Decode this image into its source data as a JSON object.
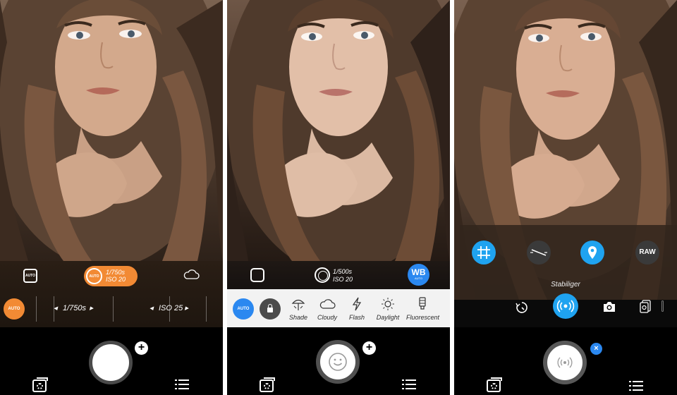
{
  "panel1": {
    "mode_icon_label": "AUTO",
    "exposure_pill": {
      "ring_label": "AUTO",
      "shutter": "1/750s",
      "iso": "ISO 20"
    },
    "auto_button": "AUTO",
    "shutter_dial": "1/750s",
    "iso_dial": "ISO 25",
    "icons": {
      "mode": "auto-mode-icon",
      "weather": "cloud-icon",
      "gallery": "gallery-icon",
      "menu": "list-icon",
      "add": "plus-icon"
    },
    "accent_color": "#f28a34"
  },
  "panel2": {
    "exposure": {
      "shutter": "1/500s",
      "iso": "ISO 20"
    },
    "wb_button": {
      "label": "WB",
      "sublabel": "AUTO"
    },
    "auto_button": "AUTO",
    "presets": [
      {
        "label": "Shade",
        "icon": "shade-icon"
      },
      {
        "label": "Cloudy",
        "icon": "cloud-icon"
      },
      {
        "label": "Flash",
        "icon": "flash-icon"
      },
      {
        "label": "Daylight",
        "icon": "sun-icon"
      },
      {
        "label": "Fluorescent",
        "icon": "fluorescent-icon"
      }
    ],
    "accent_color": "#2b88f0"
  },
  "panel3": {
    "top_row": [
      {
        "name": "grid-icon"
      },
      {
        "name": "level-icon"
      },
      {
        "name": "location-icon"
      },
      {
        "name": "raw-button",
        "label": "RAW"
      }
    ],
    "stabilizer_label": "Stabiliger",
    "bottom_row": [
      "timer-icon",
      "stabilizer-icon",
      "camera-icon",
      "burst-icon"
    ],
    "close_badge": "×",
    "accent_color": "#1fa3f0"
  }
}
